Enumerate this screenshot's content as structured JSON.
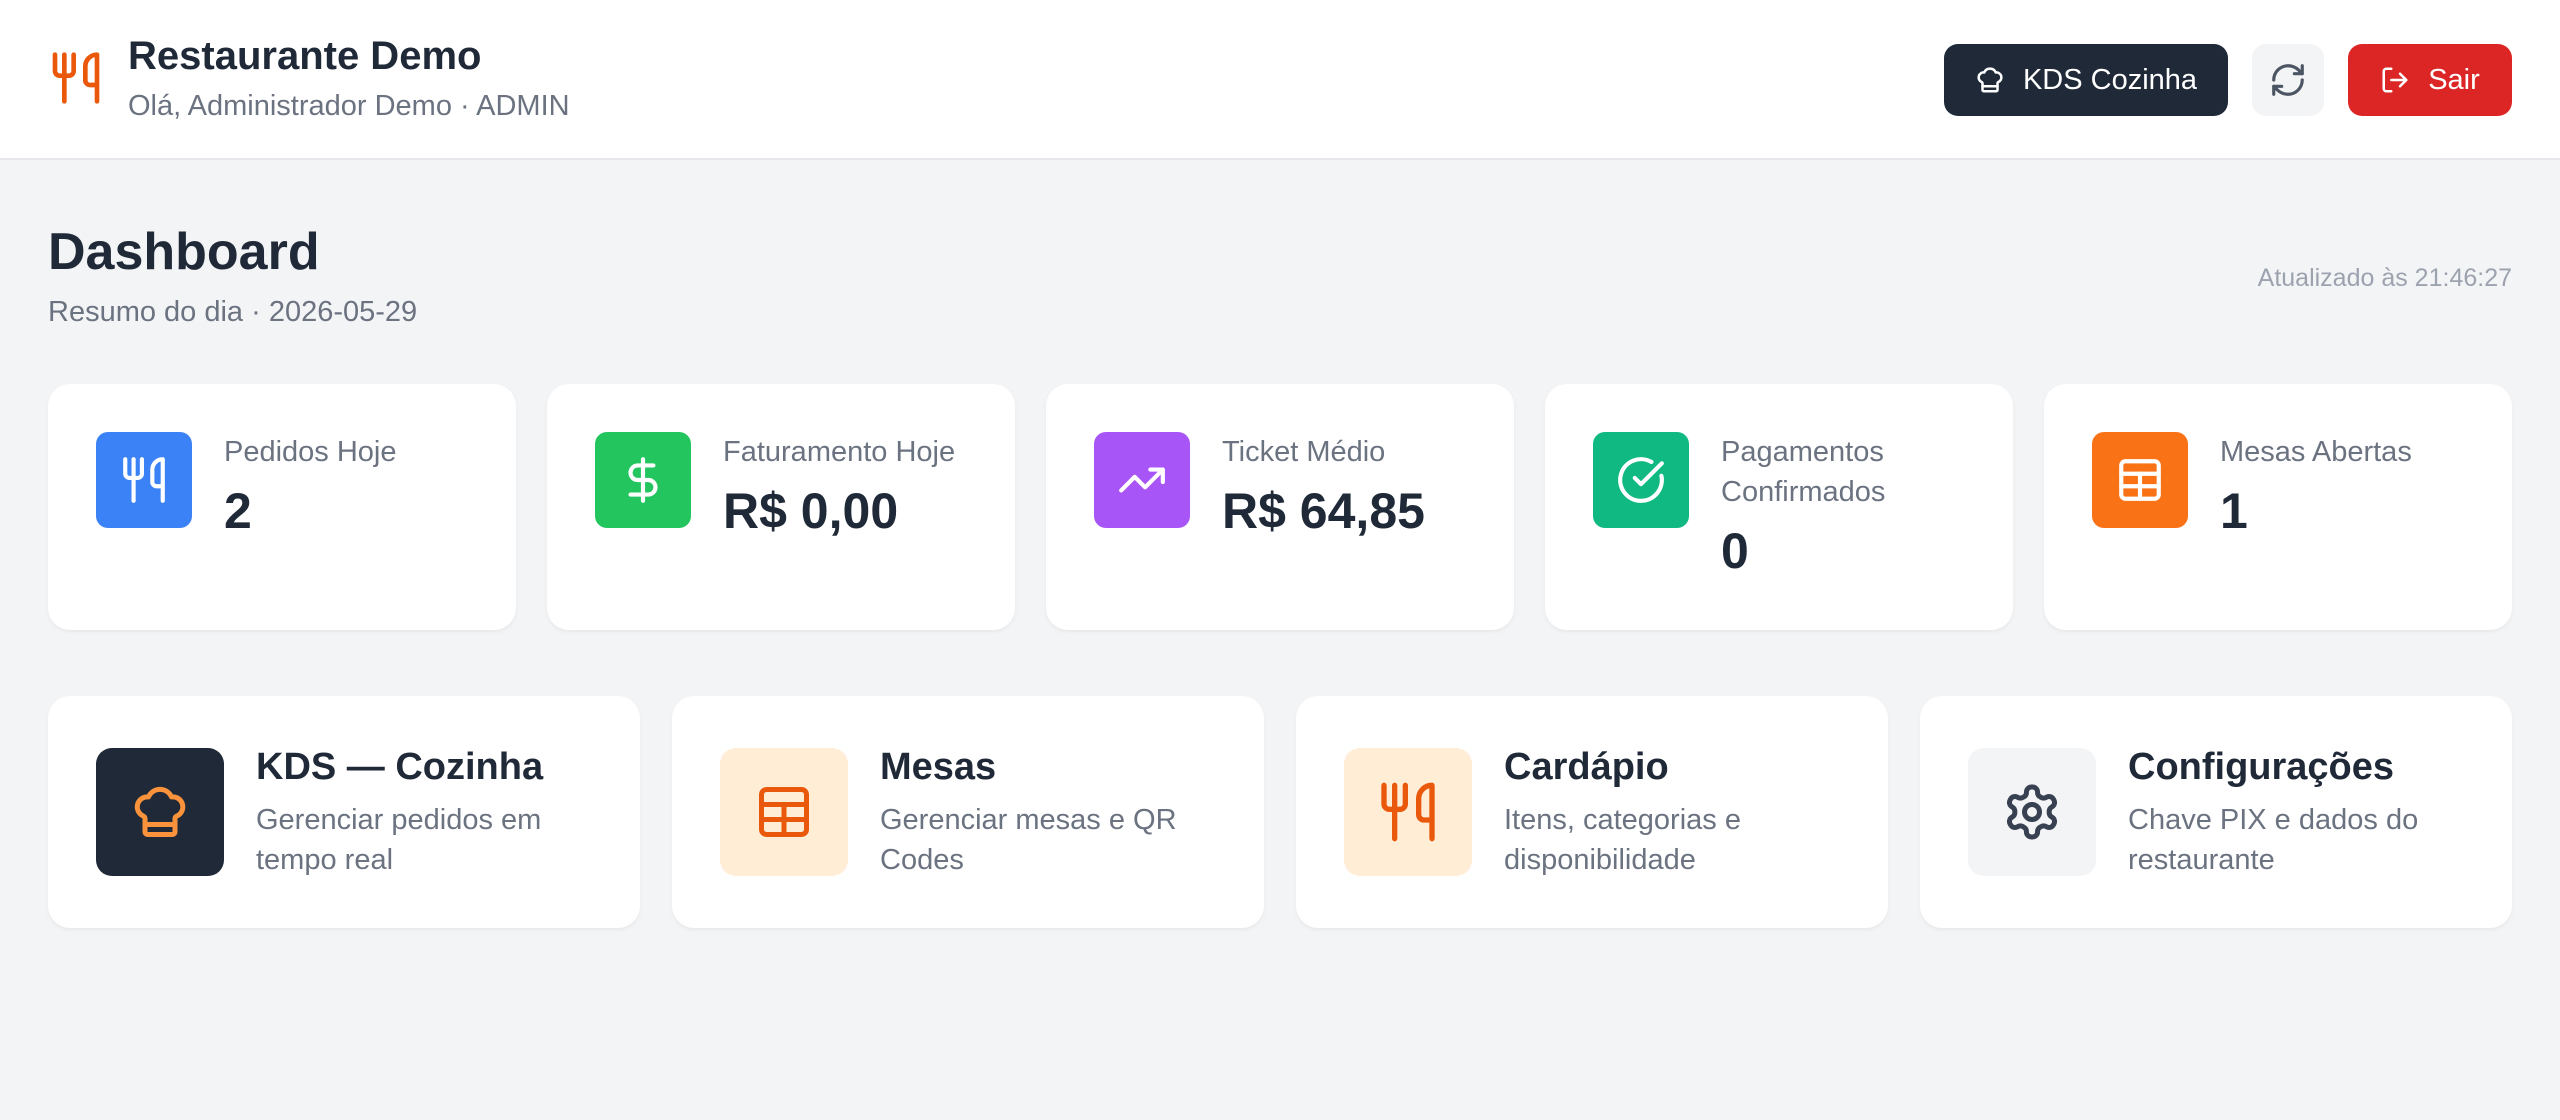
{
  "header": {
    "title": "Restaurante Demo",
    "subtitle": "Olá, Administrador Demo · ADMIN",
    "kds_button": "KDS Cozinha",
    "exit_button": "Sair"
  },
  "page": {
    "title": "Dashboard",
    "subtitle": "Resumo do dia · 2026-05-29",
    "updated": "Atualizado às 21:46:27"
  },
  "stats": [
    {
      "label": "Pedidos Hoje",
      "value": "2",
      "icon": "utensils-icon",
      "color": "#3b82f6"
    },
    {
      "label": "Faturamento Hoje",
      "value": "R$ 0,00",
      "icon": "dollar-icon",
      "color": "#22c55e"
    },
    {
      "label": "Ticket Médio",
      "value": "R$ 64,85",
      "icon": "trending-up-icon",
      "color": "#a855f7"
    },
    {
      "label": "Pagamentos Confirmados",
      "value": "0",
      "icon": "check-circle-icon",
      "color": "#10b981"
    },
    {
      "label": "Mesas Abertas",
      "value": "1",
      "icon": "table-grid-icon",
      "color": "#f97316"
    }
  ],
  "nav": [
    {
      "title": "KDS — Cozinha",
      "desc": "Gerenciar pedidos em tempo real",
      "icon": "chef-hat-icon",
      "bg": "#1f2937",
      "fg": "#fb923c"
    },
    {
      "title": "Mesas",
      "desc": "Gerenciar mesas e QR Codes",
      "icon": "table-grid-icon",
      "bg": "#ffedd5",
      "fg": "#ea580c"
    },
    {
      "title": "Cardápio",
      "desc": "Itens, categorias e disponibilidade",
      "icon": "utensils-icon",
      "bg": "#ffedd5",
      "fg": "#ea580c"
    },
    {
      "title": "Configurações",
      "desc": "Chave PIX e dados do restaurante",
      "icon": "gear-icon",
      "bg": "#f3f4f6",
      "fg": "#374151"
    }
  ]
}
